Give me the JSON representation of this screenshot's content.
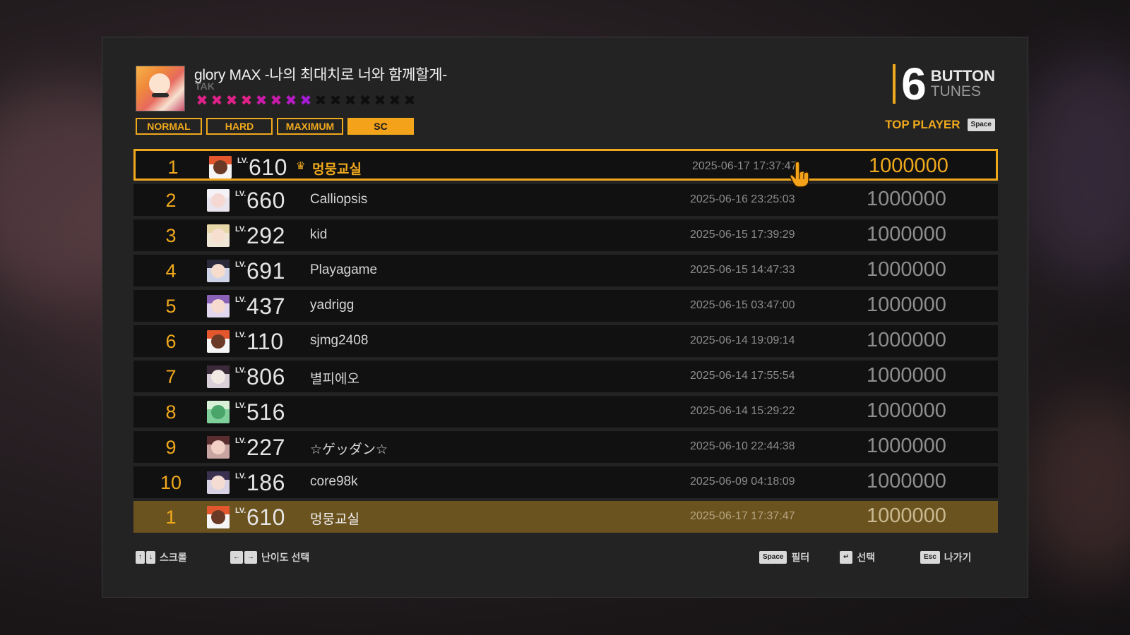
{
  "song": {
    "title": "glory MAX -나의 최대치로 너와 함께할게-",
    "artist": "TAK",
    "stars": [
      {
        "color": "#e0218a"
      },
      {
        "color": "#e0218a"
      },
      {
        "color": "#e0218a"
      },
      {
        "color": "#e0218a"
      },
      {
        "color": "#c81ba8"
      },
      {
        "color": "#c81ba8"
      },
      {
        "color": "#b71cc4"
      },
      {
        "color": "#a51ad6"
      },
      {
        "color": "#0e0e0e"
      },
      {
        "color": "#0e0e0e"
      },
      {
        "color": "#0e0e0e"
      },
      {
        "color": "#0e0e0e"
      },
      {
        "color": "#0e0e0e"
      },
      {
        "color": "#0e0e0e"
      },
      {
        "color": "#0e0e0e"
      }
    ],
    "star_glyph": "✖",
    "rated_stars": 8,
    "max_stars": 15
  },
  "difficulty_tabs": [
    {
      "label": "NORMAL",
      "active": false
    },
    {
      "label": "HARD",
      "active": false
    },
    {
      "label": "MAXIMUM",
      "active": false
    },
    {
      "label": "SC",
      "active": true
    }
  ],
  "brand": {
    "num": "6",
    "line1": "BUTTON",
    "line2": "TUNES"
  },
  "top_player": {
    "label": "TOP PLAYER",
    "key": "Space"
  },
  "ranking": [
    {
      "rank": "1",
      "lv": "LV.",
      "level": "610",
      "name": "멍뭉교실",
      "date": "2025-06-17 17:37:47",
      "score": "1000000",
      "crown": "♛",
      "avatar": "astronaut"
    },
    {
      "rank": "2",
      "lv": "LV.",
      "level": "660",
      "name": "Calliopsis",
      "date": "2025-06-16 23:25:03",
      "score": "1000000",
      "crown": "",
      "avatar": "girl-white"
    },
    {
      "rank": "3",
      "lv": "LV.",
      "level": "292",
      "name": "kid",
      "date": "2025-06-15 17:39:29",
      "score": "1000000",
      "crown": "",
      "avatar": "girl-blonde"
    },
    {
      "rank": "4",
      "lv": "LV.",
      "level": "691",
      "name": "Playagame",
      "date": "2025-06-15 14:47:33",
      "score": "1000000",
      "crown": "",
      "avatar": "girl-dark"
    },
    {
      "rank": "5",
      "lv": "LV.",
      "level": "437",
      "name": "yadrigg",
      "date": "2025-06-15 03:47:00",
      "score": "1000000",
      "crown": "",
      "avatar": "girl-purple"
    },
    {
      "rank": "6",
      "lv": "LV.",
      "level": "110",
      "name": "sjmg2408",
      "date": "2025-06-14 19:09:14",
      "score": "1000000",
      "crown": "",
      "avatar": "astronaut"
    },
    {
      "rank": "7",
      "lv": "LV.",
      "level": "806",
      "name": "별피에오",
      "date": "2025-06-14 17:55:54",
      "score": "1000000",
      "crown": "",
      "avatar": "girl-mask"
    },
    {
      "rank": "8",
      "lv": "LV.",
      "level": "516",
      "name": "",
      "date": "2025-06-14 15:29:22",
      "score": "1000000",
      "crown": "",
      "avatar": "green"
    },
    {
      "rank": "9",
      "lv": "LV.",
      "level": "227",
      "name": "☆ゲッダン☆",
      "date": "2025-06-10 22:44:38",
      "score": "1000000",
      "crown": "",
      "avatar": "girl-brown"
    },
    {
      "rank": "10",
      "lv": "LV.",
      "level": "186",
      "name": "core98k",
      "date": "2025-06-09 04:18:09",
      "score": "1000000",
      "crown": "",
      "avatar": "girl-glasses"
    }
  ],
  "my_record": {
    "rank": "1",
    "lv": "LV.",
    "level": "610",
    "name": "멍뭉교실",
    "date": "2025-06-17 17:37:47",
    "score": "1000000",
    "avatar": "astronaut"
  },
  "footer": {
    "scroll": {
      "keys": [
        "↑",
        "↓"
      ],
      "label": "스크롤"
    },
    "difficulty": {
      "keys": [
        "←",
        "→"
      ],
      "label": "난이도 선택"
    },
    "filter": {
      "key": "Space",
      "label": "필터"
    },
    "select": {
      "key": "↵",
      "label": "선택"
    },
    "exit": {
      "key": "Esc",
      "label": "나가기"
    }
  },
  "colors": {
    "accent": "#f0a91d",
    "row_bg": "#111111",
    "my_row_bg": "#6b5320"
  }
}
